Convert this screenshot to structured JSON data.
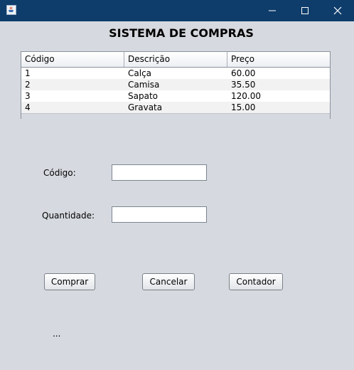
{
  "window": {
    "icon": "java-app-icon",
    "controls": [
      "minimize-icon",
      "maximize-icon",
      "close-icon"
    ]
  },
  "heading": "SISTEMA DE COMPRAS",
  "table": {
    "columns": [
      "Código",
      "Descrição",
      "Preço"
    ],
    "rows": [
      [
        "1",
        "Calça",
        "60.00"
      ],
      [
        "2",
        "Camisa",
        "35.50"
      ],
      [
        "3",
        "Sapato",
        "120.00"
      ],
      [
        "4",
        "Gravata",
        "15.00"
      ]
    ]
  },
  "form": {
    "codigo_label": "Código:",
    "codigo_value": "",
    "quantidade_label": "Quantidade:",
    "quantidade_value": ""
  },
  "buttons": {
    "comprar": "Comprar",
    "cancelar": "Cancelar",
    "contador": "Contador"
  },
  "status_text": "...",
  "colors": {
    "titlebar": "#0f3d6b",
    "background": "#d6d9df"
  }
}
